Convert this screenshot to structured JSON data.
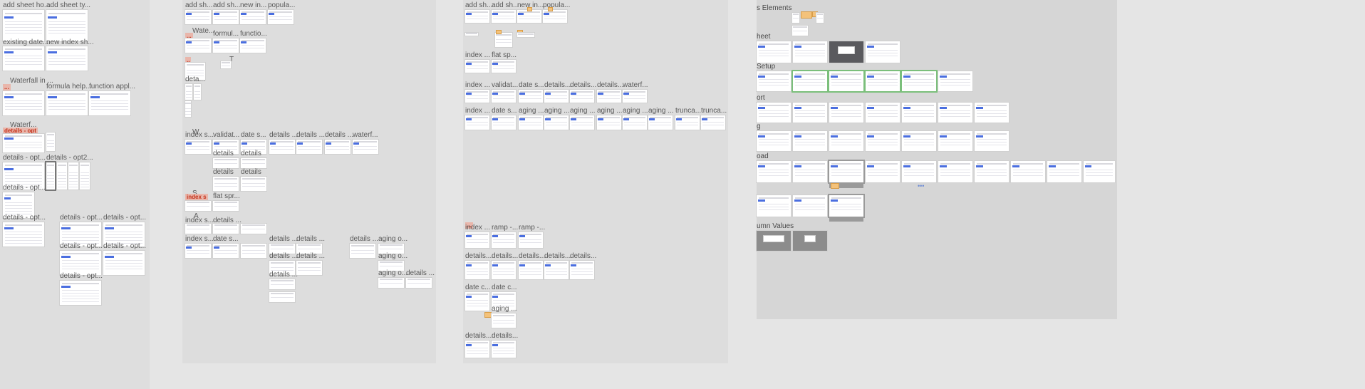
{
  "labels": {
    "c1_add_sheet_ho": "add sheet ho...",
    "c1_add_sheet_ty": "add sheet ty...",
    "c1_existing_date": "existing date...",
    "c1_new_index_sh": "new index sh...",
    "c1_waterfall_in": "Waterfall in ...",
    "c1_formula_help": "formula help...",
    "c1_function_appl": "function appl...",
    "c1_waterf": "Waterf...",
    "c1_details_opt_a": "details - opt...",
    "c1_details_opt2": "details - opt2...",
    "c1_details_opt_b": "details - opt...",
    "c1_details_opt_c": "details - opt...",
    "c1_details_opt_d": "details - opt...",
    "c1_details_opt_e": "details - opt...",
    "c1_details_opt_f": "details - opt...",
    "c1_details_opt_g": "details - opt...",
    "c1_details_opt_h": "details - opt...",
    "c2_add_sh_a": "add sh...",
    "c2_add_sh_b": "add sh...",
    "c2_new_in": "new in...",
    "c2_popula": "popula...",
    "c2_wate": "Wate...",
    "c2_formul": "formul...",
    "c2_functio": "functio...",
    "c2_t": "T",
    "c2_deta": "deta...",
    "c2_w": "W",
    "c2_index_s": "index s...",
    "c2_validat": "validat...",
    "c2_date_s": "date s...",
    "c2_details_a": "details ...",
    "c2_details_b": "details ...",
    "c2_details_c": "details ...",
    "c2_waterf": "waterf...",
    "c2_details_d": "details",
    "c2_details_e": "details",
    "c2_details_f": "details",
    "c2_details_g": "details",
    "c2_s": "S",
    "c2_index_s2": "index s...",
    "c2_flat_spr": "flat spr...",
    "c2_a": "A",
    "c2_index_s3": "index s...",
    "c2_details_h": "details ...",
    "c2_index_s4": "index s...",
    "c2_date_s2": "date s...",
    "c2_details_i": "details ...",
    "c2_details_j": "details ...",
    "c2_details_k": "details ...",
    "c2_details_l": "details ...",
    "c2_details_m": "details ...",
    "c2_details_n": "details ...",
    "c2_details_o": "details ...",
    "c2_aging_o_a": "aging o...",
    "c2_aging_o_b": "aging o...",
    "c2_aging_o_c": "aging o...",
    "c2_details_p": "details ...",
    "c3_add_sh_a": "add sh...",
    "c3_add_sh_b": "add sh...",
    "c3_new_in": "new in...",
    "c3_popula": "popula...",
    "c3_index_a": "index ...",
    "c3_flat_sp": "flat sp...",
    "c3_index_b": "index ...",
    "c3_validat": "validat...",
    "c3_date_s": "date s...",
    "c3_details_a": "details...",
    "c3_details_b": "details...",
    "c3_details_c": "details...",
    "c3_waterf": "waterf...",
    "c3_index_c": "index ...",
    "c3_date_s2": "date s...",
    "c3_aging_a": "aging ...",
    "c3_aging_b": "aging ...",
    "c3_aging_c": "aging ...",
    "c3_aging_d": "aging ...",
    "c3_aging_e": "aging ...",
    "c3_aging_f": "aging ...",
    "c3_trunca_a": "trunca...",
    "c3_trunca_b": "trunca...",
    "c3_index_d": "index ...",
    "c3_ramp_a": "ramp -...",
    "c3_ramp_b": "ramp -...",
    "c3_details_d": "details...",
    "c3_details_e": "details...",
    "c3_details_f": "details...",
    "c3_details_g": "details...",
    "c3_details_h": "details...",
    "c3_date_c_a": "date c...",
    "c3_date_c_b": "date c...",
    "c3_aging_g": "aging ...",
    "c3_details_i": "details...",
    "c3_details_j": "details...",
    "c4_s_elements": "s Elements",
    "c4_heet": "heet",
    "c4_setup": "Setup",
    "c4_ort": "ort",
    "c4_g": "g",
    "c4_oad": "oad",
    "c4_umn_values": "umn Values"
  },
  "tags": {
    "details_opt": "details - opt",
    "index_s": "index s"
  },
  "colors": {
    "canvas_bg": "#e5e5e5",
    "section_bg": "#dcdcdc",
    "accent_blue": "#4a6ee0",
    "sticky_orange": "#f4c27a",
    "selection_green": "#7bbf7b",
    "red_tag": "#c4321b"
  }
}
